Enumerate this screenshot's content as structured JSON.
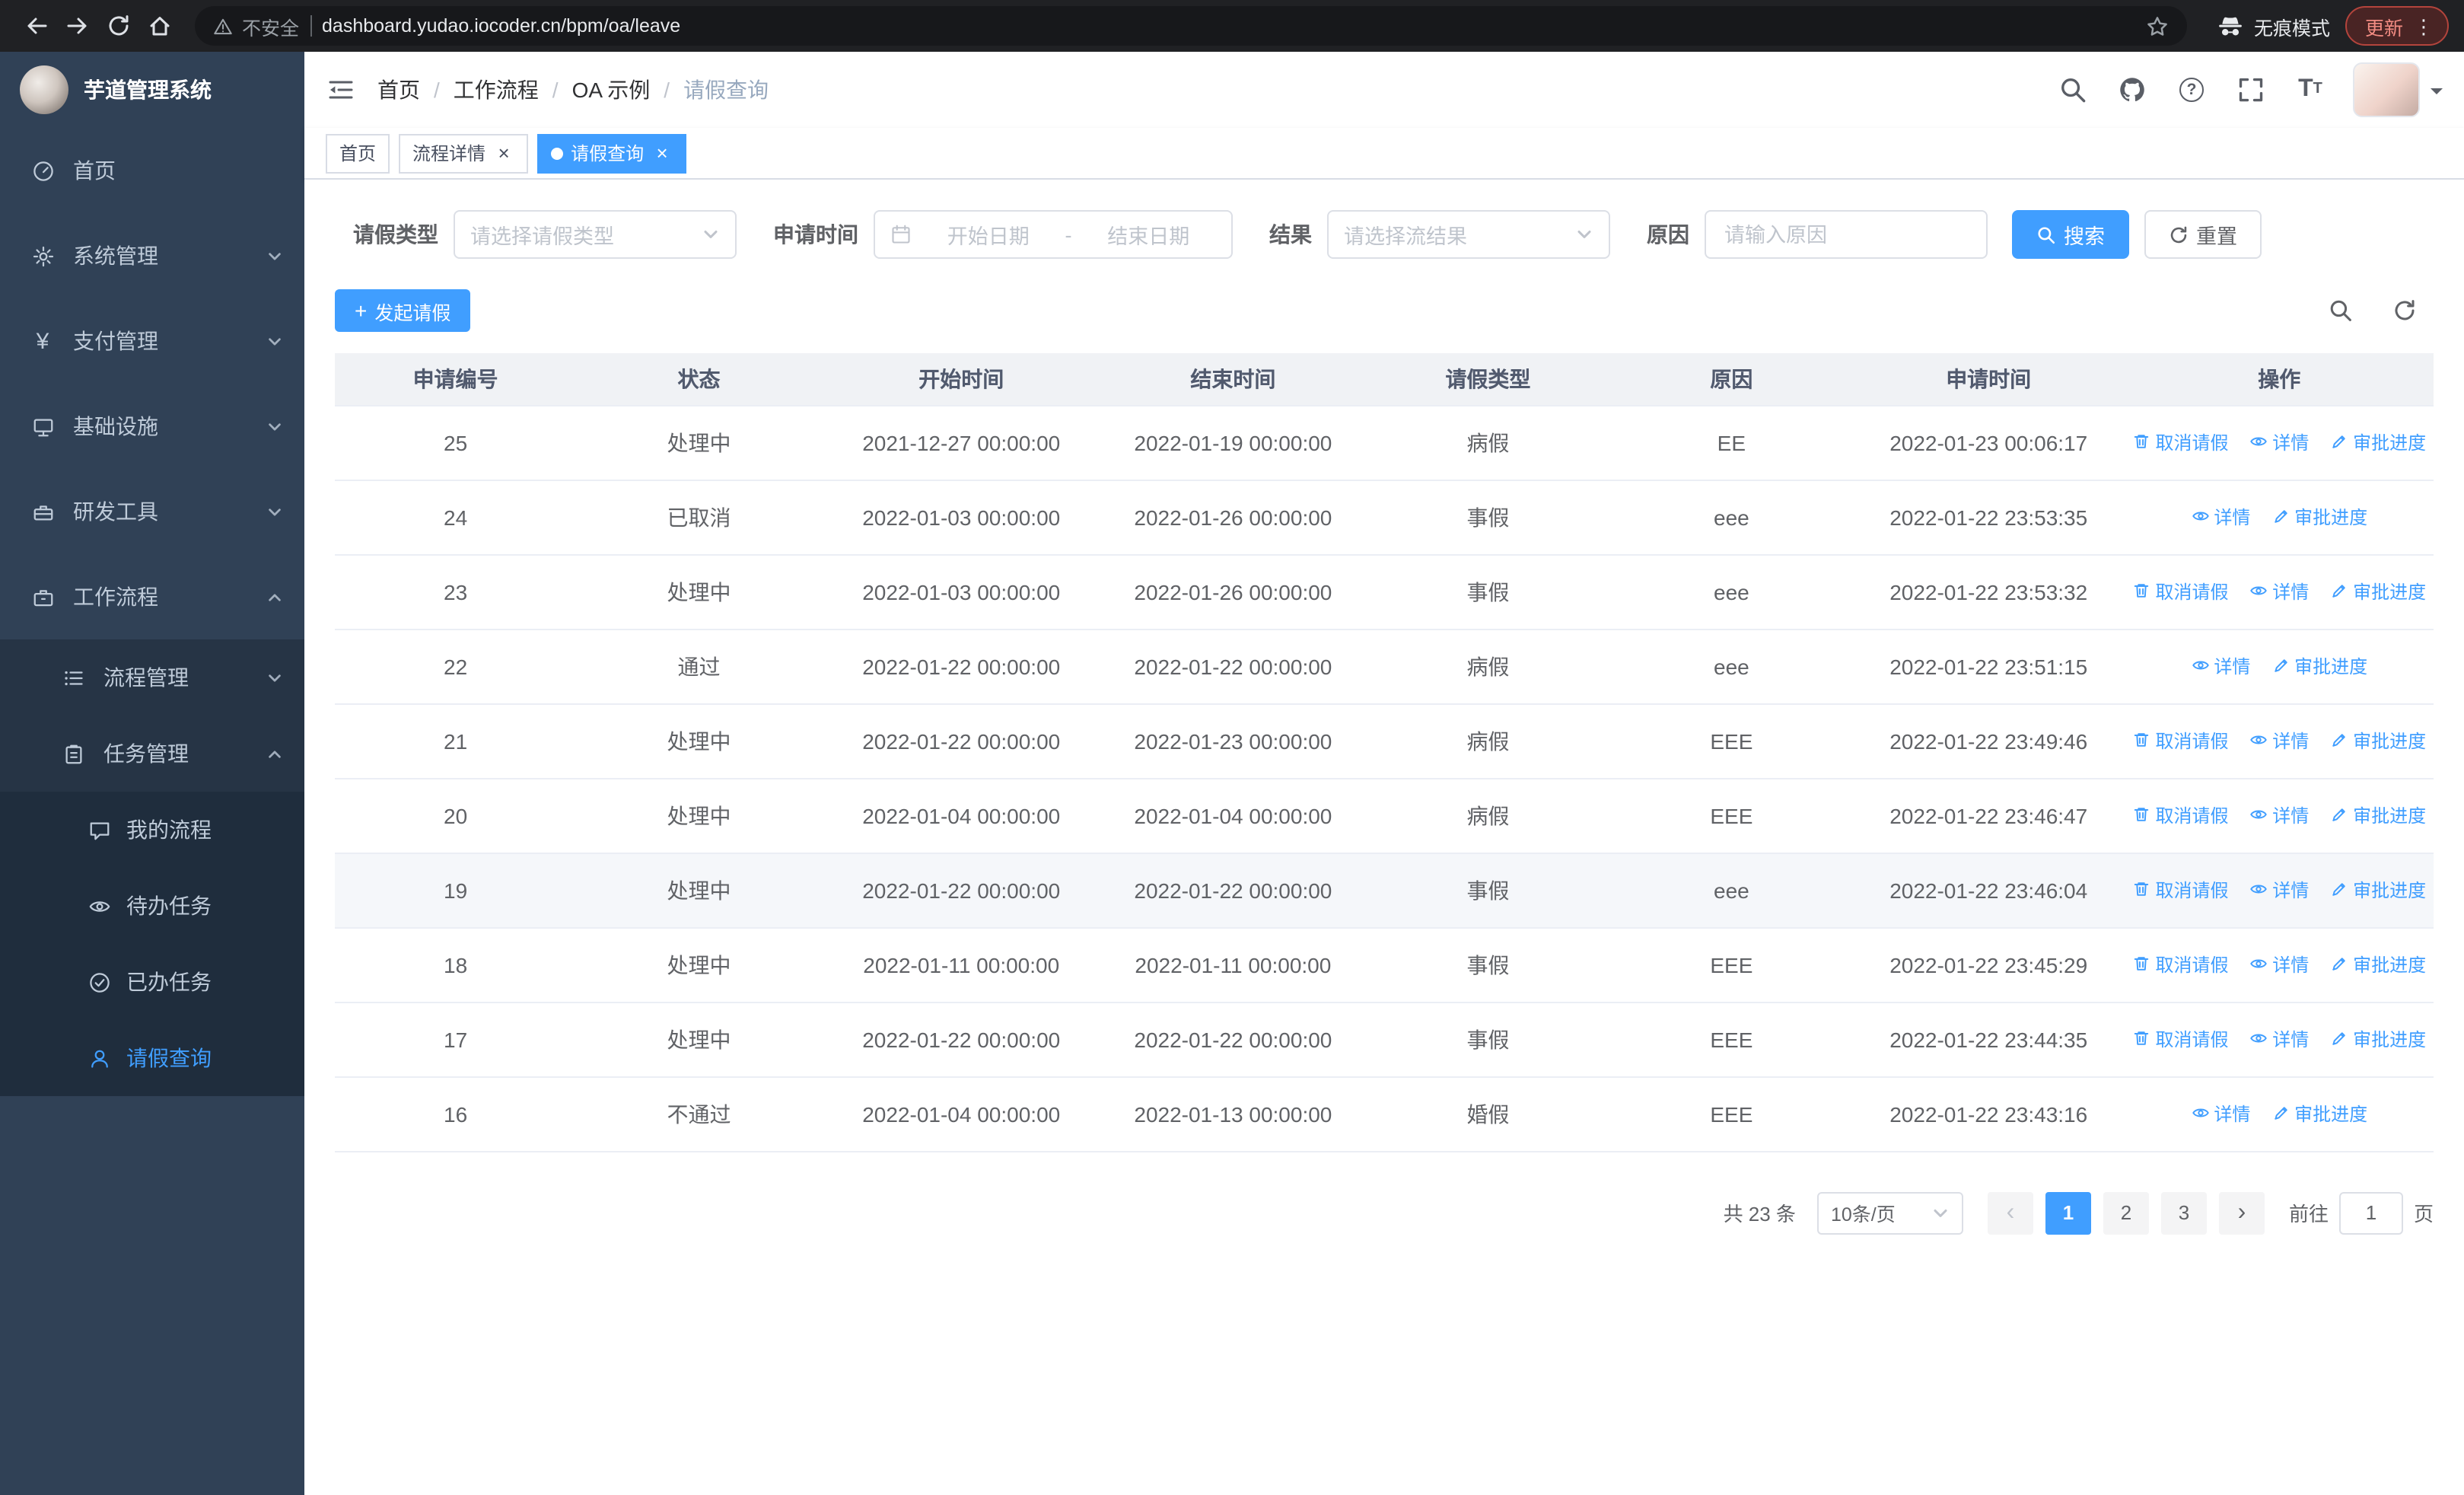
{
  "appearance": {
    "primary_color": "#409EFF",
    "sidebar_color": "#304156",
    "submenu_color": "#1F2D3D",
    "browser_bar_color": "#202124"
  },
  "browser": {
    "security_label": "不安全",
    "url": "dashboard.yudao.iocoder.cn/bpm/oa/leave",
    "incognito_label": "无痕模式",
    "update_label": "更新"
  },
  "sidebar": {
    "app_title": "芋道管理系统",
    "menu": [
      {
        "label": "首页"
      },
      {
        "label": "系统管理"
      },
      {
        "label": "支付管理"
      },
      {
        "label": "基础设施"
      },
      {
        "label": "研发工具"
      },
      {
        "label": "工作流程"
      }
    ],
    "workflow_children": [
      {
        "label": "流程管理"
      },
      {
        "label": "任务管理"
      }
    ],
    "task_children": [
      {
        "label": "我的流程"
      },
      {
        "label": "待办任务"
      },
      {
        "label": "已办任务"
      },
      {
        "label": "请假查询"
      }
    ]
  },
  "header": {
    "breadcrumbs": [
      "首页",
      "工作流程",
      "OA 示例",
      "请假查询"
    ]
  },
  "tabs": [
    {
      "label": "首页"
    },
    {
      "label": "流程详情"
    },
    {
      "label": "请假查询"
    }
  ],
  "filters": {
    "leave_type_label": "请假类型",
    "leave_type_placeholder": "请选择请假类型",
    "apply_time_label": "申请时间",
    "start_date_placeholder": "开始日期",
    "range_separator": "-",
    "end_date_placeholder": "结束日期",
    "result_label": "结果",
    "result_placeholder": "请选择流结果",
    "reason_label": "原因",
    "reason_placeholder": "请输入原因",
    "search_button": "搜索",
    "reset_button": "重置"
  },
  "toolbar": {
    "create_button": "发起请假"
  },
  "table": {
    "columns": [
      "申请编号",
      "状态",
      "开始时间",
      "结束时间",
      "请假类型",
      "原因",
      "申请时间",
      "操作"
    ],
    "actions": {
      "cancel": "取消请假",
      "detail": "详情",
      "progress": "审批进度"
    },
    "rows": [
      {
        "id": "25",
        "status": "处理中",
        "start": "2021-12-27 00:00:00",
        "end": "2022-01-19 00:00:00",
        "type": "病假",
        "reason": "EE",
        "apply": "2022-01-23 00:06:17",
        "cancellable": true,
        "highlight": false
      },
      {
        "id": "24",
        "status": "已取消",
        "start": "2022-01-03 00:00:00",
        "end": "2022-01-26 00:00:00",
        "type": "事假",
        "reason": "eee",
        "apply": "2022-01-22 23:53:35",
        "cancellable": false,
        "highlight": false
      },
      {
        "id": "23",
        "status": "处理中",
        "start": "2022-01-03 00:00:00",
        "end": "2022-01-26 00:00:00",
        "type": "事假",
        "reason": "eee",
        "apply": "2022-01-22 23:53:32",
        "cancellable": true,
        "highlight": false
      },
      {
        "id": "22",
        "status": "通过",
        "start": "2022-01-22 00:00:00",
        "end": "2022-01-22 00:00:00",
        "type": "病假",
        "reason": "eee",
        "apply": "2022-01-22 23:51:15",
        "cancellable": false,
        "highlight": false
      },
      {
        "id": "21",
        "status": "处理中",
        "start": "2022-01-22 00:00:00",
        "end": "2022-01-23 00:00:00",
        "type": "病假",
        "reason": "EEE",
        "apply": "2022-01-22 23:49:46",
        "cancellable": true,
        "highlight": false
      },
      {
        "id": "20",
        "status": "处理中",
        "start": "2022-01-04 00:00:00",
        "end": "2022-01-04 00:00:00",
        "type": "病假",
        "reason": "EEE",
        "apply": "2022-01-22 23:46:47",
        "cancellable": true,
        "highlight": false
      },
      {
        "id": "19",
        "status": "处理中",
        "start": "2022-01-22 00:00:00",
        "end": "2022-01-22 00:00:00",
        "type": "事假",
        "reason": "eee",
        "apply": "2022-01-22 23:46:04",
        "cancellable": true,
        "highlight": true
      },
      {
        "id": "18",
        "status": "处理中",
        "start": "2022-01-11 00:00:00",
        "end": "2022-01-11 00:00:00",
        "type": "事假",
        "reason": "EEE",
        "apply": "2022-01-22 23:45:29",
        "cancellable": true,
        "highlight": false
      },
      {
        "id": "17",
        "status": "处理中",
        "start": "2022-01-22 00:00:00",
        "end": "2022-01-22 00:00:00",
        "type": "事假",
        "reason": "EEE",
        "apply": "2022-01-22 23:44:35",
        "cancellable": true,
        "highlight": false
      },
      {
        "id": "16",
        "status": "不通过",
        "start": "2022-01-04 00:00:00",
        "end": "2022-01-13 00:00:00",
        "type": "婚假",
        "reason": "EEE",
        "apply": "2022-01-22 23:43:16",
        "cancellable": false,
        "highlight": false
      }
    ]
  },
  "pagination": {
    "total": "共 23 条",
    "page_size": "10条/页",
    "pages": [
      "1",
      "2",
      "3"
    ],
    "active_page": "1",
    "goto_label": "前往",
    "goto_value": "1",
    "page_label": "页"
  }
}
